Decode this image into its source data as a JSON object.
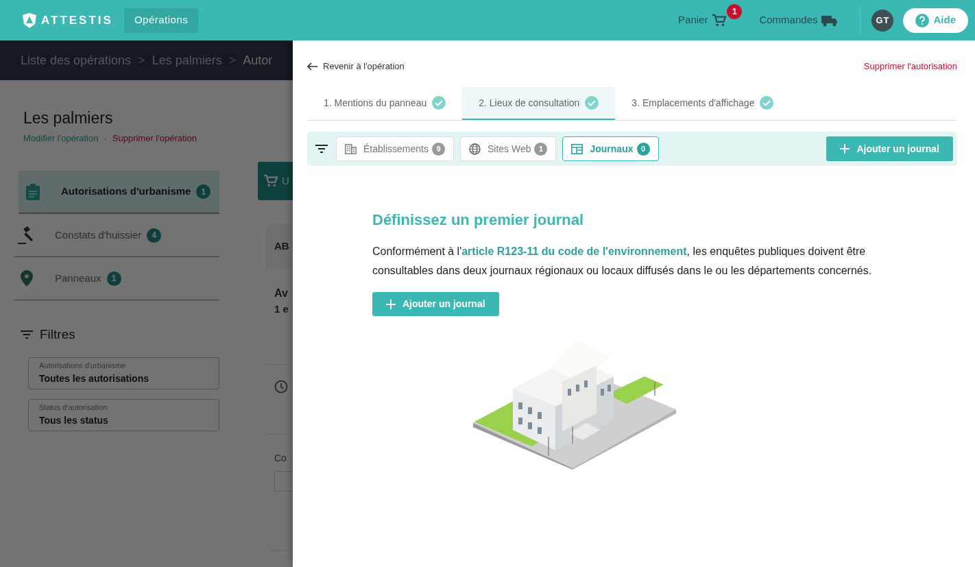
{
  "header": {
    "logo": "ATTESTIS",
    "nav": [
      {
        "label": "Opérations",
        "selected": true
      }
    ],
    "cart": {
      "label": "Panier",
      "count": "1"
    },
    "orders": {
      "label": "Commandes"
    },
    "avatar": "GT",
    "help": "Aide"
  },
  "background": {
    "breadcrumb": [
      {
        "label": "Liste des opérations",
        "separator": ">"
      },
      {
        "label": "Les palmiers",
        "separator": ">"
      },
      {
        "label": "Autor"
      }
    ],
    "title": "Les palmiers",
    "edit_link": "Modifier l'opération",
    "dot": "·",
    "delete_link": "Supprimer l'opération",
    "sidebar": [
      {
        "kind": "clipboard",
        "label": "Autorisations d'urbanisme",
        "count": "1",
        "selected": true
      },
      {
        "kind": "gavel",
        "label": "Constats d'huissier",
        "count": "4",
        "selected": false
      },
      {
        "kind": "pin",
        "label": "Panneaux",
        "count": "1",
        "selected": false
      }
    ],
    "filters": {
      "title": "Filtres",
      "fields": [
        {
          "label": "Autorisations d'urbanisme",
          "value": "Toutes les autorisations"
        },
        {
          "label": "Status d'autorisation",
          "value": "Tous les status"
        }
      ]
    },
    "main": {
      "cart_button": "U",
      "card_header": "AB",
      "card_title": "Av",
      "card_line": "1 e",
      "card_label": "Co"
    }
  },
  "panel": {
    "back": "Revenir à l'opération",
    "delete": "Supprimer l'autorisation",
    "steps": [
      {
        "label": "1. Mentions du panneau",
        "done": true,
        "selected": false
      },
      {
        "label": "2. Lieux de consultation",
        "done": true,
        "selected": true
      },
      {
        "label": "3. Emplacements d'affichage",
        "done": true,
        "selected": false
      }
    ],
    "filters": [
      {
        "kind": "building",
        "label": "Établissements",
        "count": "9",
        "selected": false
      },
      {
        "kind": "globe",
        "label": "Sites Web",
        "count": "1",
        "selected": false
      },
      {
        "kind": "newspaper",
        "label": "Journaux",
        "count": "0",
        "selected": true
      }
    ],
    "add_button": "Ajouter un journal",
    "empty": {
      "title": "Définissez un premier journal",
      "text_before": "Conformément à l'",
      "link": "article R123-11 du code de l'environnement",
      "text_after": ", les enquêtes publiques doivent être consultables dans deux journaux régionaux ou locaux diffusés dans le ou les départements concernés.",
      "button": "Ajouter un journal"
    }
  }
}
